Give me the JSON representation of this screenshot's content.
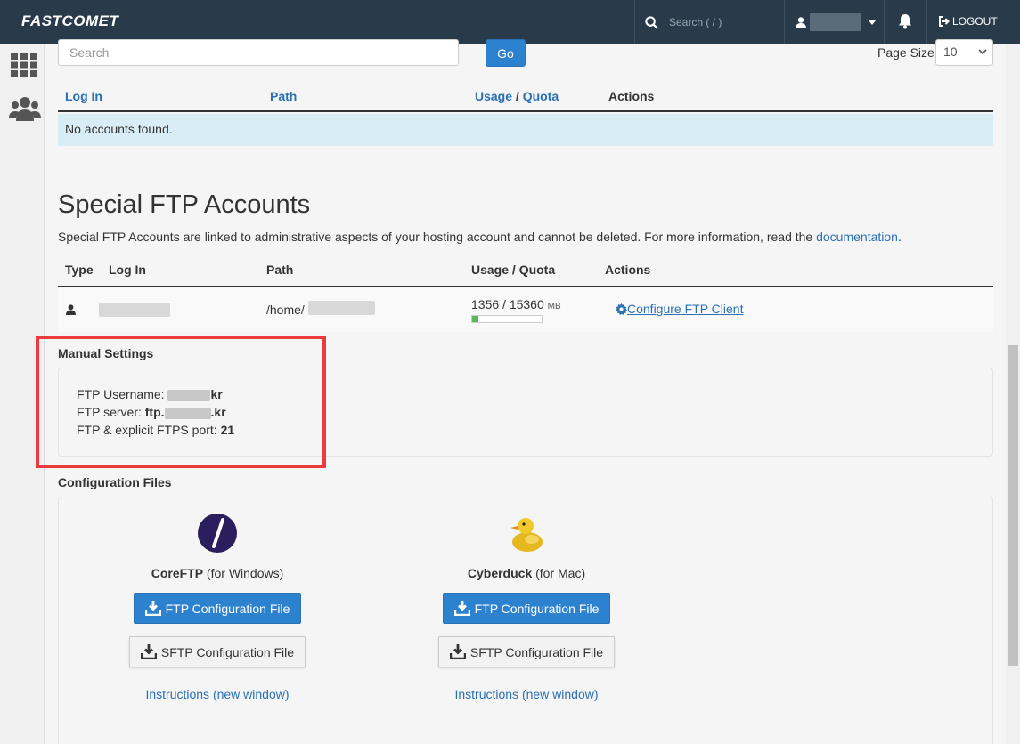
{
  "topbar": {
    "brand": "FASTCOMET",
    "search_placeholder": "Search ( / )",
    "logout_label": "LOGOUT"
  },
  "list": {
    "search_placeholder": "Search",
    "go_label": "Go",
    "page_size_label": "Page Size",
    "page_size_value": "10",
    "columns": {
      "login": "Log In",
      "path": "Path",
      "usage": "Usage",
      "slash": " / ",
      "quota": "Quota",
      "actions": "Actions"
    },
    "empty_message": "No accounts found."
  },
  "special": {
    "title": "Special FTP Accounts",
    "description": "Special FTP Accounts are linked to administrative aspects of your hosting account and cannot be deleted. For more information, read the ",
    "doc_link": "documentation",
    "period": ".",
    "columns": {
      "type": "Type",
      "login": "Log In",
      "path": "Path",
      "usage_quota": "Usage / Quota",
      "actions": "Actions"
    },
    "row": {
      "path_prefix": "/home/",
      "usage": "1356 / 15360",
      "unit": "MB",
      "usage_fraction": 0.088,
      "configure_label": " Configure FTP Client"
    }
  },
  "manual": {
    "heading": "Manual Settings",
    "username_label": "FTP Username: ",
    "username_suffix": "kr",
    "server_label": "FTP server: ",
    "server_prefix": "ftp.",
    "server_suffix": ".kr",
    "port_label": "FTP & explicit FTPS port:  ",
    "port_value": "21"
  },
  "config": {
    "heading": "Configuration Files",
    "clients": [
      {
        "name": "CoreFTP",
        "platform": " (for Windows)",
        "ftp_button": "FTP Configuration File",
        "sftp_button": "SFTP Configuration File",
        "instructions": "Instructions (new window)"
      },
      {
        "name": "Cyberduck",
        "platform": " (for Mac)",
        "ftp_button": "FTP Configuration File",
        "sftp_button": "SFTP Configuration File",
        "instructions": "Instructions (new window)"
      }
    ]
  },
  "colors": {
    "navbar": "#293a4a",
    "link": "#2a70b5",
    "primary": "#2d82d0",
    "highlight": "#ec3a41",
    "info": "#d9edf7"
  }
}
